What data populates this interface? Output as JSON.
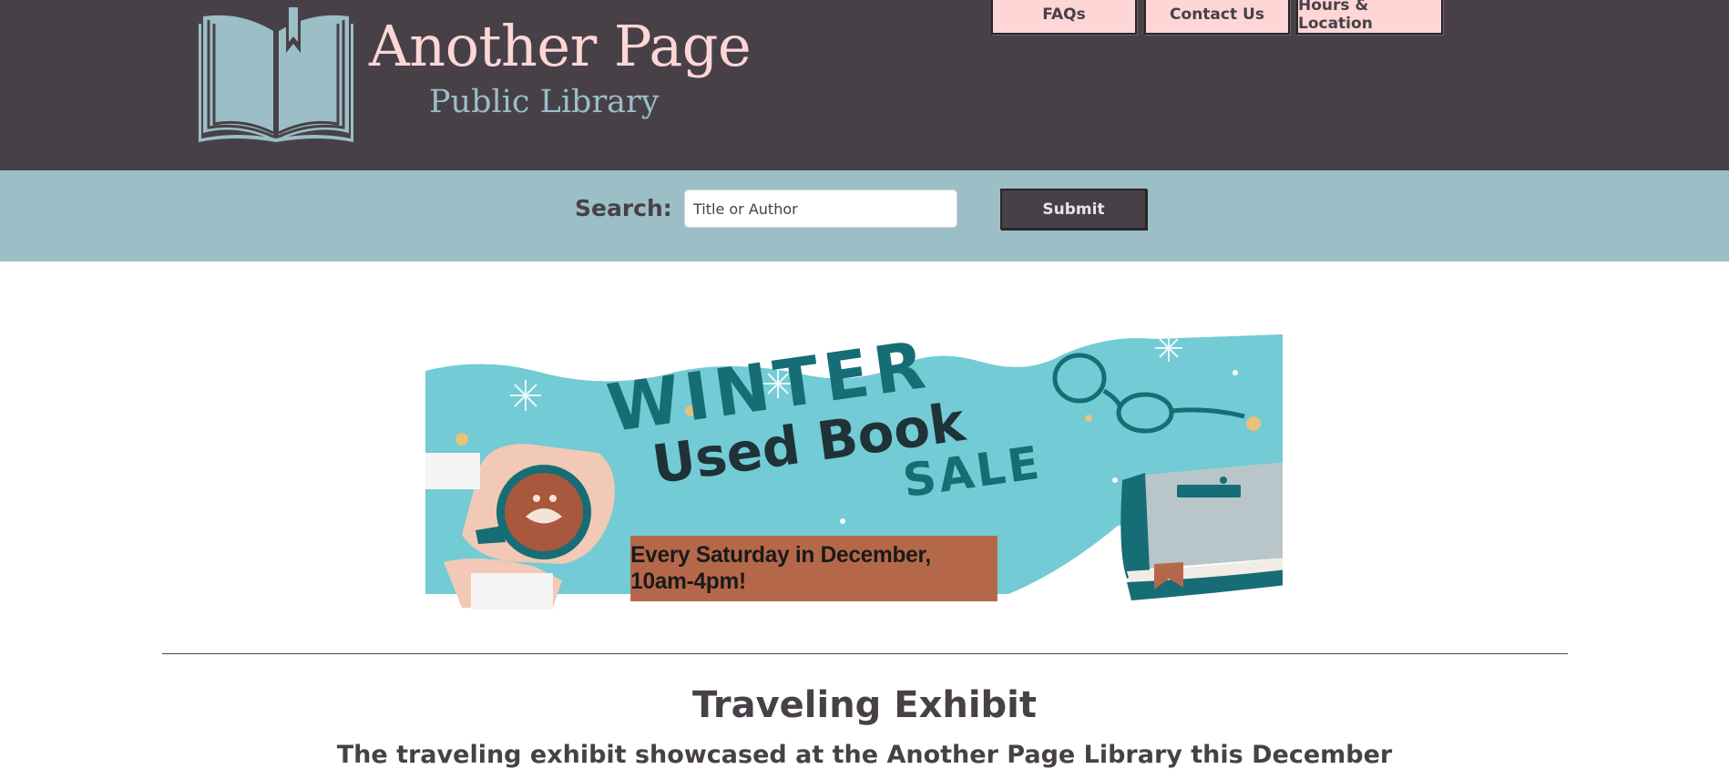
{
  "brand": {
    "title": "Another Page",
    "subtitle": "Public Library",
    "logo_icon": "open-book-icon"
  },
  "nav": {
    "items": [
      {
        "label": "FAQs"
      },
      {
        "label": "Contact Us"
      },
      {
        "label": "Hours & Location"
      }
    ]
  },
  "search": {
    "label": "Search:",
    "placeholder": "Title or Author",
    "value": "",
    "submit_label": "Submit"
  },
  "carousel": {
    "slide": {
      "headline_1": "WINTER",
      "headline_2": "Used Book",
      "headline_3": "SALE",
      "banner": "Every Saturday in December, 10am-4pm!"
    },
    "prev_icon": "chevron-left-icon",
    "next_icon": "chevron-right-icon"
  },
  "exhibit": {
    "title": "Traveling Exhibit",
    "text": "The traveling exhibit showcased at the Another Page Library this December"
  },
  "colors": {
    "header_bg": "#474147",
    "accent_pink": "#ffd6d6",
    "accent_blue": "#9bbec7",
    "slide_teal": "#72cbd5",
    "banner_rust": "#b56849"
  }
}
